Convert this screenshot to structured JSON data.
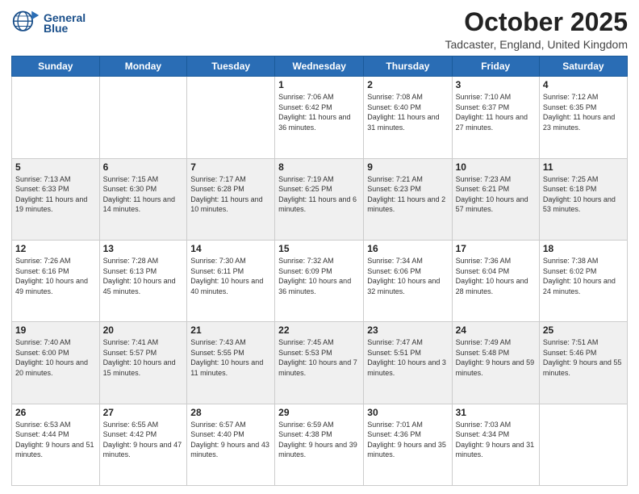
{
  "header": {
    "logo_line1": "General",
    "logo_line2": "Blue",
    "month": "October 2025",
    "location": "Tadcaster, England, United Kingdom"
  },
  "days_of_week": [
    "Sunday",
    "Monday",
    "Tuesday",
    "Wednesday",
    "Thursday",
    "Friday",
    "Saturday"
  ],
  "weeks": [
    [
      {
        "day": null
      },
      {
        "day": null
      },
      {
        "day": null
      },
      {
        "day": "1",
        "sunrise": "7:06 AM",
        "sunset": "6:42 PM",
        "daylight": "11 hours and 36 minutes."
      },
      {
        "day": "2",
        "sunrise": "7:08 AM",
        "sunset": "6:40 PM",
        "daylight": "11 hours and 31 minutes."
      },
      {
        "day": "3",
        "sunrise": "7:10 AM",
        "sunset": "6:37 PM",
        "daylight": "11 hours and 27 minutes."
      },
      {
        "day": "4",
        "sunrise": "7:12 AM",
        "sunset": "6:35 PM",
        "daylight": "11 hours and 23 minutes."
      }
    ],
    [
      {
        "day": "5",
        "sunrise": "7:13 AM",
        "sunset": "6:33 PM",
        "daylight": "11 hours and 19 minutes."
      },
      {
        "day": "6",
        "sunrise": "7:15 AM",
        "sunset": "6:30 PM",
        "daylight": "11 hours and 14 minutes."
      },
      {
        "day": "7",
        "sunrise": "7:17 AM",
        "sunset": "6:28 PM",
        "daylight": "11 hours and 10 minutes."
      },
      {
        "day": "8",
        "sunrise": "7:19 AM",
        "sunset": "6:25 PM",
        "daylight": "11 hours and 6 minutes."
      },
      {
        "day": "9",
        "sunrise": "7:21 AM",
        "sunset": "6:23 PM",
        "daylight": "11 hours and 2 minutes."
      },
      {
        "day": "10",
        "sunrise": "7:23 AM",
        "sunset": "6:21 PM",
        "daylight": "10 hours and 57 minutes."
      },
      {
        "day": "11",
        "sunrise": "7:25 AM",
        "sunset": "6:18 PM",
        "daylight": "10 hours and 53 minutes."
      }
    ],
    [
      {
        "day": "12",
        "sunrise": "7:26 AM",
        "sunset": "6:16 PM",
        "daylight": "10 hours and 49 minutes."
      },
      {
        "day": "13",
        "sunrise": "7:28 AM",
        "sunset": "6:13 PM",
        "daylight": "10 hours and 45 minutes."
      },
      {
        "day": "14",
        "sunrise": "7:30 AM",
        "sunset": "6:11 PM",
        "daylight": "10 hours and 40 minutes."
      },
      {
        "day": "15",
        "sunrise": "7:32 AM",
        "sunset": "6:09 PM",
        "daylight": "10 hours and 36 minutes."
      },
      {
        "day": "16",
        "sunrise": "7:34 AM",
        "sunset": "6:06 PM",
        "daylight": "10 hours and 32 minutes."
      },
      {
        "day": "17",
        "sunrise": "7:36 AM",
        "sunset": "6:04 PM",
        "daylight": "10 hours and 28 minutes."
      },
      {
        "day": "18",
        "sunrise": "7:38 AM",
        "sunset": "6:02 PM",
        "daylight": "10 hours and 24 minutes."
      }
    ],
    [
      {
        "day": "19",
        "sunrise": "7:40 AM",
        "sunset": "6:00 PM",
        "daylight": "10 hours and 20 minutes."
      },
      {
        "day": "20",
        "sunrise": "7:41 AM",
        "sunset": "5:57 PM",
        "daylight": "10 hours and 15 minutes."
      },
      {
        "day": "21",
        "sunrise": "7:43 AM",
        "sunset": "5:55 PM",
        "daylight": "10 hours and 11 minutes."
      },
      {
        "day": "22",
        "sunrise": "7:45 AM",
        "sunset": "5:53 PM",
        "daylight": "10 hours and 7 minutes."
      },
      {
        "day": "23",
        "sunrise": "7:47 AM",
        "sunset": "5:51 PM",
        "daylight": "10 hours and 3 minutes."
      },
      {
        "day": "24",
        "sunrise": "7:49 AM",
        "sunset": "5:48 PM",
        "daylight": "9 hours and 59 minutes."
      },
      {
        "day": "25",
        "sunrise": "7:51 AM",
        "sunset": "5:46 PM",
        "daylight": "9 hours and 55 minutes."
      }
    ],
    [
      {
        "day": "26",
        "sunrise": "6:53 AM",
        "sunset": "4:44 PM",
        "daylight": "9 hours and 51 minutes."
      },
      {
        "day": "27",
        "sunrise": "6:55 AM",
        "sunset": "4:42 PM",
        "daylight": "9 hours and 47 minutes."
      },
      {
        "day": "28",
        "sunrise": "6:57 AM",
        "sunset": "4:40 PM",
        "daylight": "9 hours and 43 minutes."
      },
      {
        "day": "29",
        "sunrise": "6:59 AM",
        "sunset": "4:38 PM",
        "daylight": "9 hours and 39 minutes."
      },
      {
        "day": "30",
        "sunrise": "7:01 AM",
        "sunset": "4:36 PM",
        "daylight": "9 hours and 35 minutes."
      },
      {
        "day": "31",
        "sunrise": "7:03 AM",
        "sunset": "4:34 PM",
        "daylight": "9 hours and 31 minutes."
      },
      {
        "day": null
      }
    ]
  ]
}
